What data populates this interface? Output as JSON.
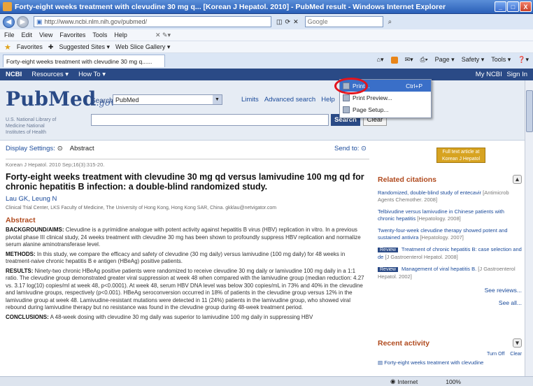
{
  "window": {
    "title": "Forty-eight weeks treatment with clevudine 30 mg q... [Korean J Hepatol. 2010] - PubMed result - Windows Internet Explorer",
    "minimize": "_",
    "maximize": "□",
    "close": "X"
  },
  "address_bar": {
    "url": "http://www.ncbi.nlm.nih.gov/pubmed/",
    "search_placeholder": "Google"
  },
  "menu": [
    "File",
    "Edit",
    "View",
    "Favorites",
    "Tools",
    "Help"
  ],
  "favorites_bar": {
    "favorites": "Favorites",
    "suggested": "Suggested Sites ▾",
    "slice": "Web Slice Gallery ▾"
  },
  "tab": {
    "label": "Forty-eight weeks treatment with clevudine 30 mg q......"
  },
  "command_bar": {
    "page": "Page ▾",
    "safety": "Safety ▾",
    "tools": "Tools ▾"
  },
  "print_menu": {
    "items": [
      {
        "label": "Print...",
        "shortcut": "Ctrl+P"
      },
      {
        "label": "Print Preview...",
        "shortcut": ""
      },
      {
        "label": "Page Setup...",
        "shortcut": ""
      }
    ]
  },
  "ncbi_bar": {
    "ncbi": "NCBI",
    "resources": "Resources ▾",
    "howto": "How To ▾",
    "my_ncbi": "My NCBI",
    "sign_in": "Sign In"
  },
  "pubmed": {
    "logo_pub": "Pub",
    "logo_med": "Med",
    "logo_gov": ".gov",
    "library": "U.S. National Library of Medicine National Institutes of Health",
    "search_label": "Search",
    "db_value": "PubMed",
    "links": [
      "Limits",
      "Advanced search",
      "Help"
    ],
    "search_button": "Search",
    "clear_button": "Clear"
  },
  "display": {
    "settings": "Display Settings:",
    "format": "Abstract",
    "send_to": "Send to:",
    "journal_badge": "Full text article at Korean J Hepatol"
  },
  "article": {
    "citation": "Korean J Hepatol. 2010 Sep;16(3):315-20.",
    "title": "Forty-eight weeks treatment with clevudine 30 mg qd versus lamivudine 100 mg qd for chronic hepatitis B infection: a double-blind randomized study.",
    "authors": "Lau GK, Leung N",
    "affiliation": "Clinical Trial Center, LKS Faculty of Medicine, The University of Hong Kong, Hong Kong SAR, China. gkklau@netvigator.com",
    "abstract_header": "Abstract",
    "background_label": "BACKGROUND/AIMS:",
    "background": "Clevudine is a pyrimidine analogue with potent activity against hepatitis B virus (HBV) replication in vitro. In a previous pivotal phase III clinical study, 24 weeks treatment with clevudine 30 mg has been shown to profoundly suppress HBV replication and normalize serum alanine aminotransferase level.",
    "methods_label": "METHODS:",
    "methods": "In this study, we compare the efficacy and safety of clevudine (30 mg daily) versus lamivudine (100 mg daily) for 48 weeks in treatment-naive chronic hepatitis B e antigen (HBeAg) positive patients.",
    "results_label": "RESULTS:",
    "results": "Ninety-two chronic HBeAg positive patients were randomized to receive clevudine 30 mg daily or lamivudine 100 mg daily in a 1:1 ratio. The clevudine group demonstrated greater viral suppression at week 48 when compared with the lamivudine group (median reduction: 4.27 vs. 3.17 log(10) copies/ml at week 48, p<0.0001). At week 48, serum HBV DNA level was below 300 copies/mL in 73% and 40% in the clevudine and lamivudine groups, respectively (p<0.001). HBeAg seroconversion occurred in 18% of patients in the clevudine group versus 12% in the lamivudine group at week 48. Lamivudine-resistant mutations were detected in 11 (24%) patients in the lamivudine group, who showed viral rebound during lamivudine therapy but no resistance was found in the clevudine group during 48-week treatment period.",
    "conclusions_label": "CONCLUSIONS:",
    "conclusions": "A 48-week dosing with clevudine 30 mg daily was superior to lamivudine 100 mg daily in suppressing HBV"
  },
  "related": {
    "header": "Related citations",
    "items": [
      {
        "text": "Randomized, double-blind study of entecavir",
        "src": "[Antimicrob Agents Chemother. 2008]",
        "review": false
      },
      {
        "text": "Telbivudine versus lamivudine in Chinese patients with chronic hepatitis",
        "src": "[Hepatology. 2008]",
        "review": false
      },
      {
        "text": "Twenty-four-week clevudine therapy showed potent and sustained antivira",
        "src": "[Hepatology. 2007]",
        "review": false
      },
      {
        "text": "Treatment of chronic hepatitis B: case selection and de",
        "src": "[J Gastroenterol Hepatol. 2008]",
        "review": true
      },
      {
        "text": "Management of viral hepatitis B.",
        "src": "[J Gastroenterol Hepatol. 2002]",
        "review": true
      }
    ],
    "review_label": "Review",
    "see_reviews": "See reviews...",
    "see_all": "See all..."
  },
  "recent": {
    "header": "Recent activity",
    "turn_off": "Turn Off",
    "clear": "Clear",
    "item": "Forty-eight weeks treatment with clevudine"
  },
  "status": {
    "zone": "Internet",
    "zoom": "100%"
  }
}
